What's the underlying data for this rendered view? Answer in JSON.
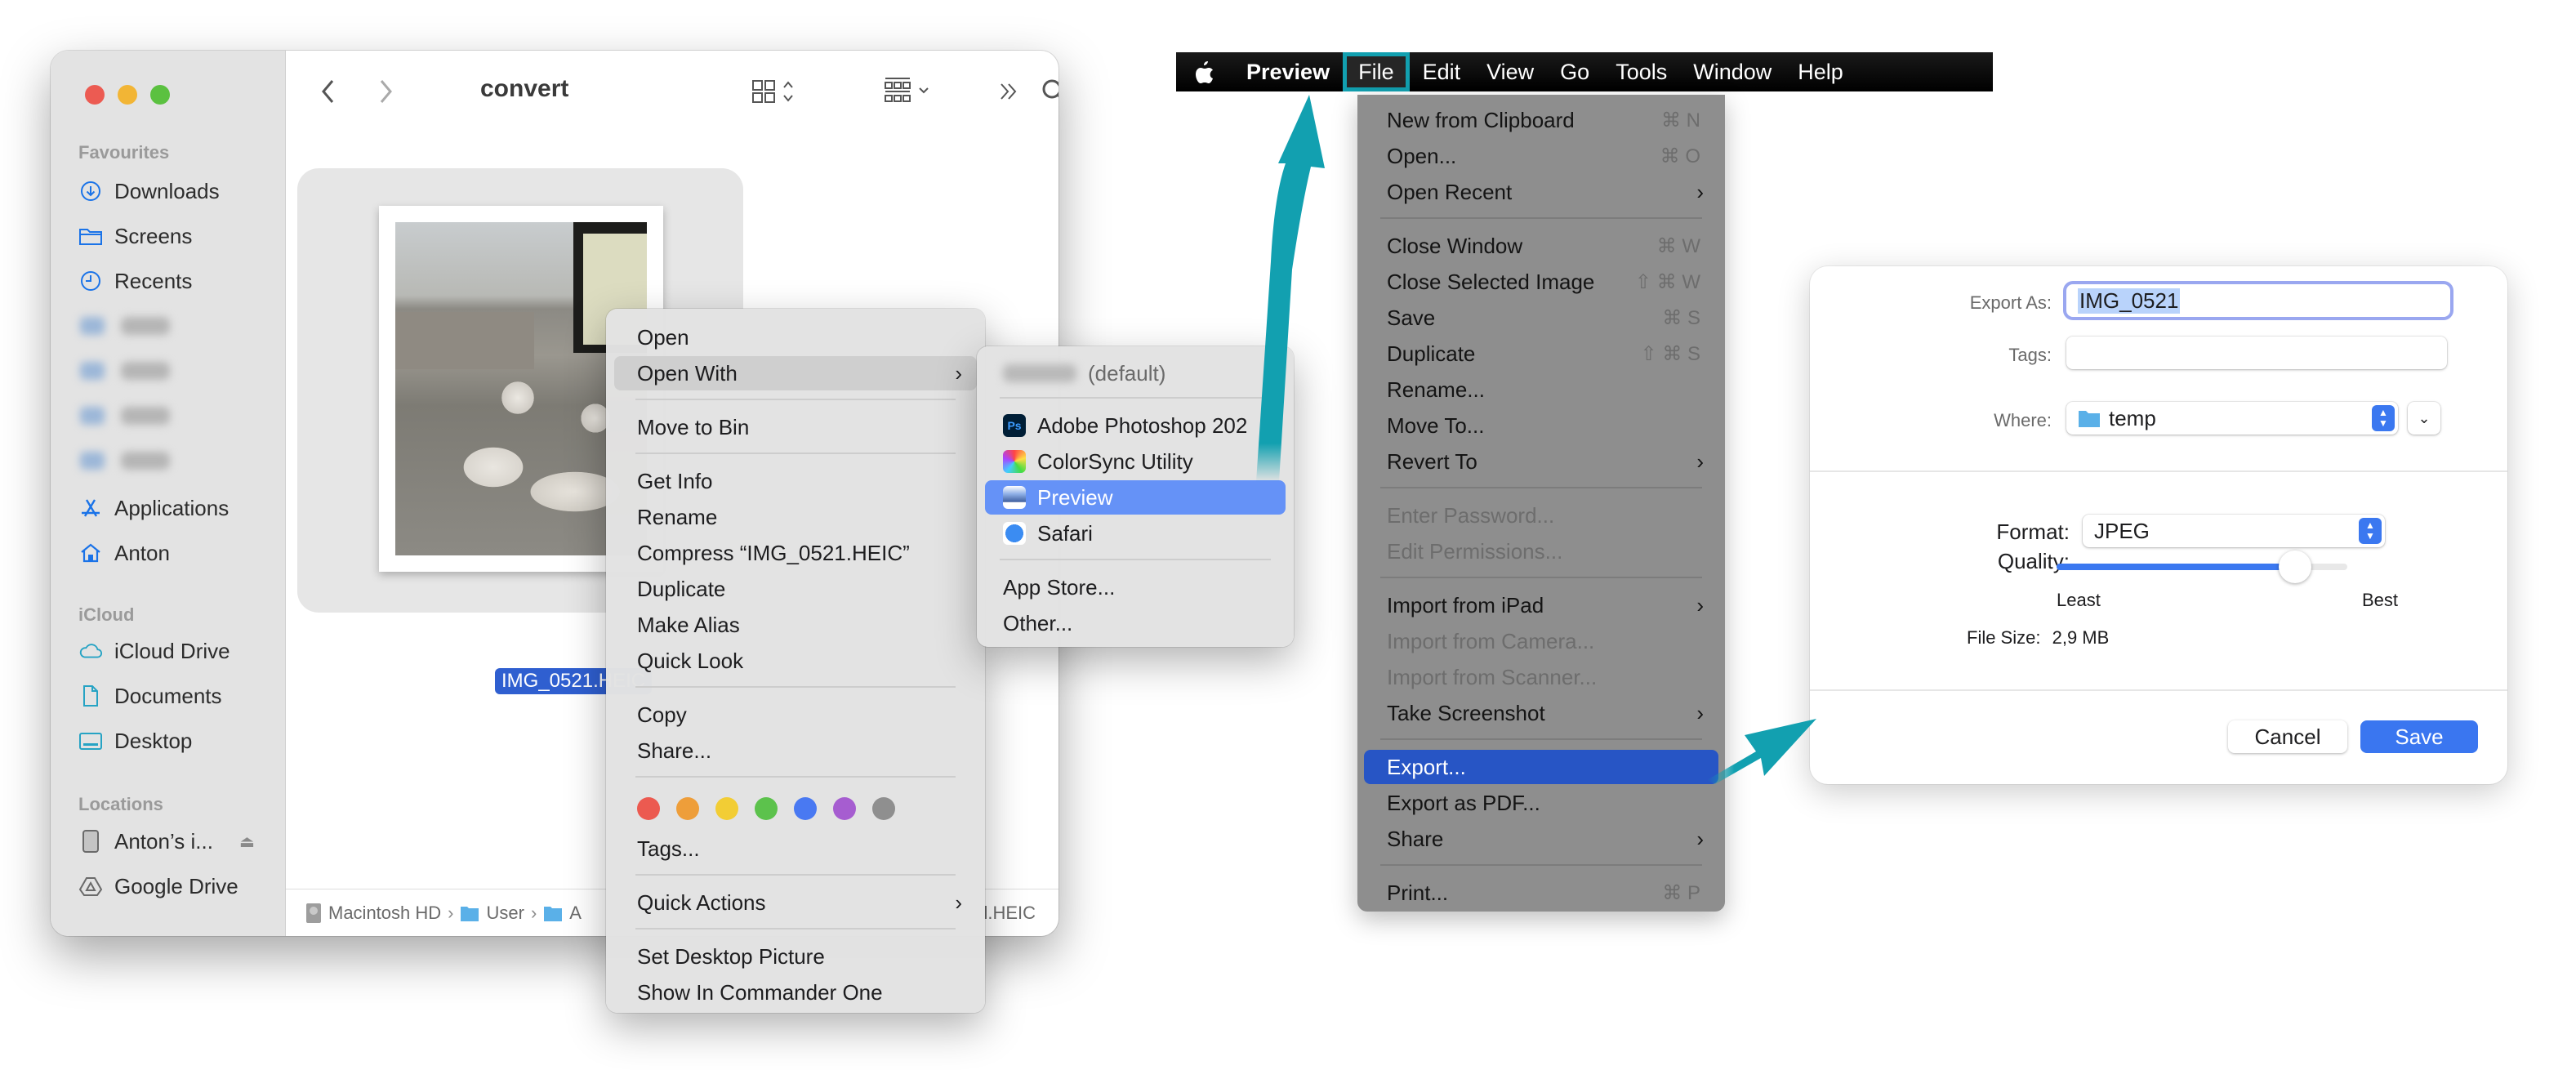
{
  "finder": {
    "title": "convert",
    "sidebar": {
      "favourites_label": "Favourites",
      "favourites": [
        {
          "label": "Downloads",
          "icon": "download-icon"
        },
        {
          "label": "Screens",
          "icon": "folder-icon"
        },
        {
          "label": "Recents",
          "icon": "clock-icon"
        }
      ],
      "blurred_items_count": 4,
      "more": [
        {
          "label": "Applications",
          "icon": "applications-icon"
        },
        {
          "label": "Anton",
          "icon": "home-icon"
        }
      ],
      "icloud_label": "iCloud",
      "icloud": [
        {
          "label": "iCloud Drive",
          "icon": "cloud-icon"
        },
        {
          "label": "Documents",
          "icon": "document-icon"
        },
        {
          "label": "Desktop",
          "icon": "desktop-icon"
        }
      ],
      "locations_label": "Locations",
      "locations": [
        {
          "label": "Anton’s i...",
          "icon": "ipad-icon",
          "eject": true
        },
        {
          "label": "Google Drive",
          "icon": "google-drive-icon"
        }
      ]
    },
    "file": {
      "name": "IMG_0521.HEIC",
      "selected": true
    },
    "pathbar": {
      "items": [
        "Macintosh HD",
        "User",
        "A"
      ],
      "tail": "l.HEIC"
    }
  },
  "context_menu": {
    "items": [
      {
        "label": "Open"
      },
      {
        "label": "Open With",
        "submenu": true,
        "hover": true
      },
      {
        "label": "Move to Bin"
      },
      {
        "label": "Get Info"
      },
      {
        "label": "Rename"
      },
      {
        "label": "Compress “IMG_0521.HEIC”"
      },
      {
        "label": "Duplicate"
      },
      {
        "label": "Make Alias"
      },
      {
        "label": "Quick Look"
      },
      {
        "label": "Copy"
      },
      {
        "label": "Share..."
      },
      {
        "label": "Tags..."
      },
      {
        "label": "Quick Actions",
        "submenu": true
      },
      {
        "label": "Set Desktop Picture"
      },
      {
        "label": "Show In Commander One"
      }
    ],
    "tag_colors": [
      {
        "name": "Red",
        "color": "#ec5a50"
      },
      {
        "name": "Orange",
        "color": "#ee9e3a"
      },
      {
        "name": "Yellow",
        "color": "#f2cd35"
      },
      {
        "name": "Green",
        "color": "#5cc24c"
      },
      {
        "name": "Blue",
        "color": "#4979f2"
      },
      {
        "name": "Purple",
        "color": "#a65dd0"
      },
      {
        "name": "Gray",
        "color": "#8f8f8f"
      }
    ]
  },
  "open_with_menu": {
    "default_suffix": "(default)",
    "apps": [
      {
        "label": "Adobe Photoshop 202",
        "icon": "photoshop-icon"
      },
      {
        "label": "ColorSync Utility",
        "icon": "colorsync-icon"
      },
      {
        "label": "Preview",
        "icon": "preview-icon",
        "selected": true
      },
      {
        "label": "Safari",
        "icon": "safari-icon"
      }
    ],
    "extra": [
      "App Store...",
      "Other..."
    ]
  },
  "menubar": {
    "app_name": "Preview",
    "items": [
      "File",
      "Edit",
      "View",
      "Go",
      "Tools",
      "Window",
      "Help"
    ],
    "active": "File"
  },
  "file_menu": {
    "items": [
      {
        "label": "New from Clipboard",
        "shortcut": "⌘ N"
      },
      {
        "label": "Open...",
        "shortcut": "⌘ O"
      },
      {
        "label": "Open Recent",
        "submenu": true
      },
      {
        "label": "Close Window",
        "shortcut": "⌘ W"
      },
      {
        "label": "Close Selected Image",
        "shortcut": "⇧ ⌘ W"
      },
      {
        "label": "Save",
        "shortcut": "⌘ S"
      },
      {
        "label": "Duplicate",
        "shortcut": "⇧ ⌘ S"
      },
      {
        "label": "Rename..."
      },
      {
        "label": "Move To..."
      },
      {
        "label": "Revert To",
        "submenu": true
      },
      {
        "label": "Enter Password...",
        "disabled": true
      },
      {
        "label": "Edit Permissions...",
        "disabled": true
      },
      {
        "label": "Import from iPad",
        "submenu": true
      },
      {
        "label": "Import from Camera...",
        "disabled": true
      },
      {
        "label": "Import from Scanner...",
        "disabled": true
      },
      {
        "label": "Take Screenshot",
        "submenu": true
      },
      {
        "label": "Export...",
        "highlighted": true
      },
      {
        "label": "Export as PDF..."
      },
      {
        "label": "Share",
        "submenu": true
      },
      {
        "label": "Print...",
        "shortcut": "⌘ P"
      }
    ]
  },
  "export_dialog": {
    "export_as_label": "Export As:",
    "export_as_value": "IMG_0521",
    "tags_label": "Tags:",
    "tags_value": "",
    "where_label": "Where:",
    "where_value": "temp",
    "format_label": "Format:",
    "format_value": "JPEG",
    "quality_label": "Quality:",
    "quality_value": 0.82,
    "quality_min_label": "Least",
    "quality_max_label": "Best",
    "file_size_label": "File Size:",
    "file_size_value": "2,9 MB",
    "cancel_label": "Cancel",
    "save_label": "Save"
  },
  "annotation_color": "#12a0b0"
}
